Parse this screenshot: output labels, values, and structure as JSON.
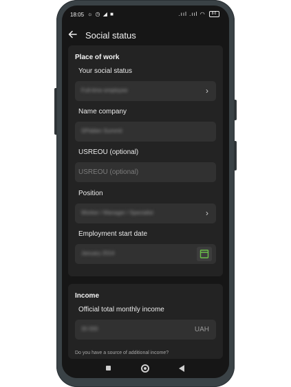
{
  "status_bar": {
    "time": "18:05",
    "left_icons": "☼ ◷ ◢ ■",
    "right_icons": ".ııl .ııl ◠",
    "battery": "80"
  },
  "header": {
    "title": "Social status"
  },
  "place_of_work": {
    "title": "Place of work",
    "social_status_label": "Your social status",
    "social_status_value": "Full-time employee",
    "company_label": "Name company",
    "company_value": "SPidden Summit",
    "usreou_label": "USREOU (optional)",
    "usreou_placeholder": "USREOU (optional)",
    "position_label": "Position",
    "position_value": "Worker / Manager / Specialist",
    "start_date_label": "Employment start date",
    "start_date_value": "January 2014"
  },
  "income": {
    "title": "Income",
    "monthly_label": "Official total monthly income",
    "monthly_value": "30 000",
    "currency": "UAH",
    "additional_question": "Do you have a source of additional income?"
  },
  "icons": {
    "back": "arrow-left-icon",
    "chevron": "chevron-right-icon",
    "calendar": "calendar-icon"
  },
  "colors": {
    "accent": "#6cc24a",
    "background": "#161616",
    "card": "#232323",
    "field": "#313131"
  }
}
